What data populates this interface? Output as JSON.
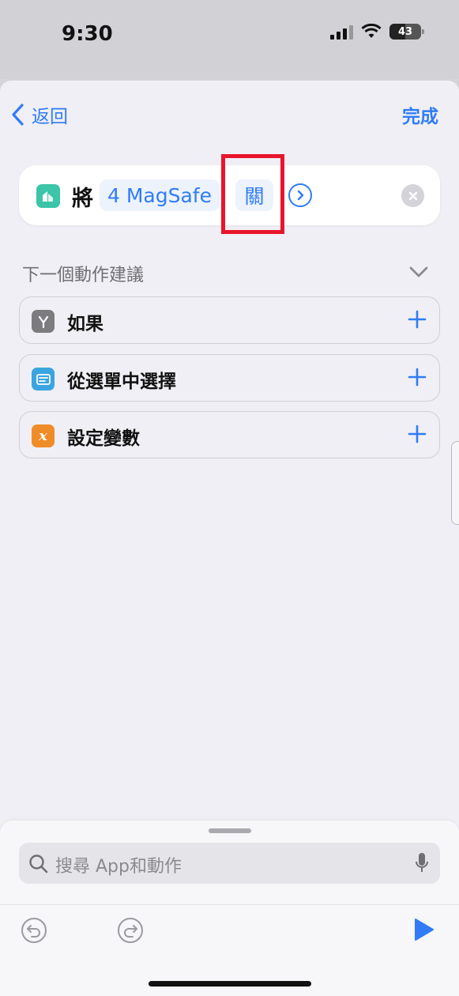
{
  "status_bar": {
    "time": "9:30",
    "battery": "43",
    "icons": [
      "signal-icon",
      "wifi-icon",
      "battery-icon"
    ]
  },
  "nav": {
    "back_label": "返回",
    "done_label": "完成"
  },
  "action": {
    "app_icon": "home-app-icon",
    "verb": "將",
    "device": "4 MagSafe",
    "state": "關"
  },
  "suggestions": {
    "title": "下一個動作建議",
    "items": [
      {
        "label": "如果",
        "icon": "branch-icon",
        "color": "#7c7c80"
      },
      {
        "label": "從選單中選擇",
        "icon": "menu-icon",
        "color": "#3aa5e0"
      },
      {
        "label": "設定變數",
        "icon": "variable-icon",
        "color": "#f08c28"
      }
    ]
  },
  "search": {
    "placeholder": "搜尋 App和動作"
  },
  "colors": {
    "accent": "#2f7cf6",
    "highlight": "#e8152b"
  }
}
